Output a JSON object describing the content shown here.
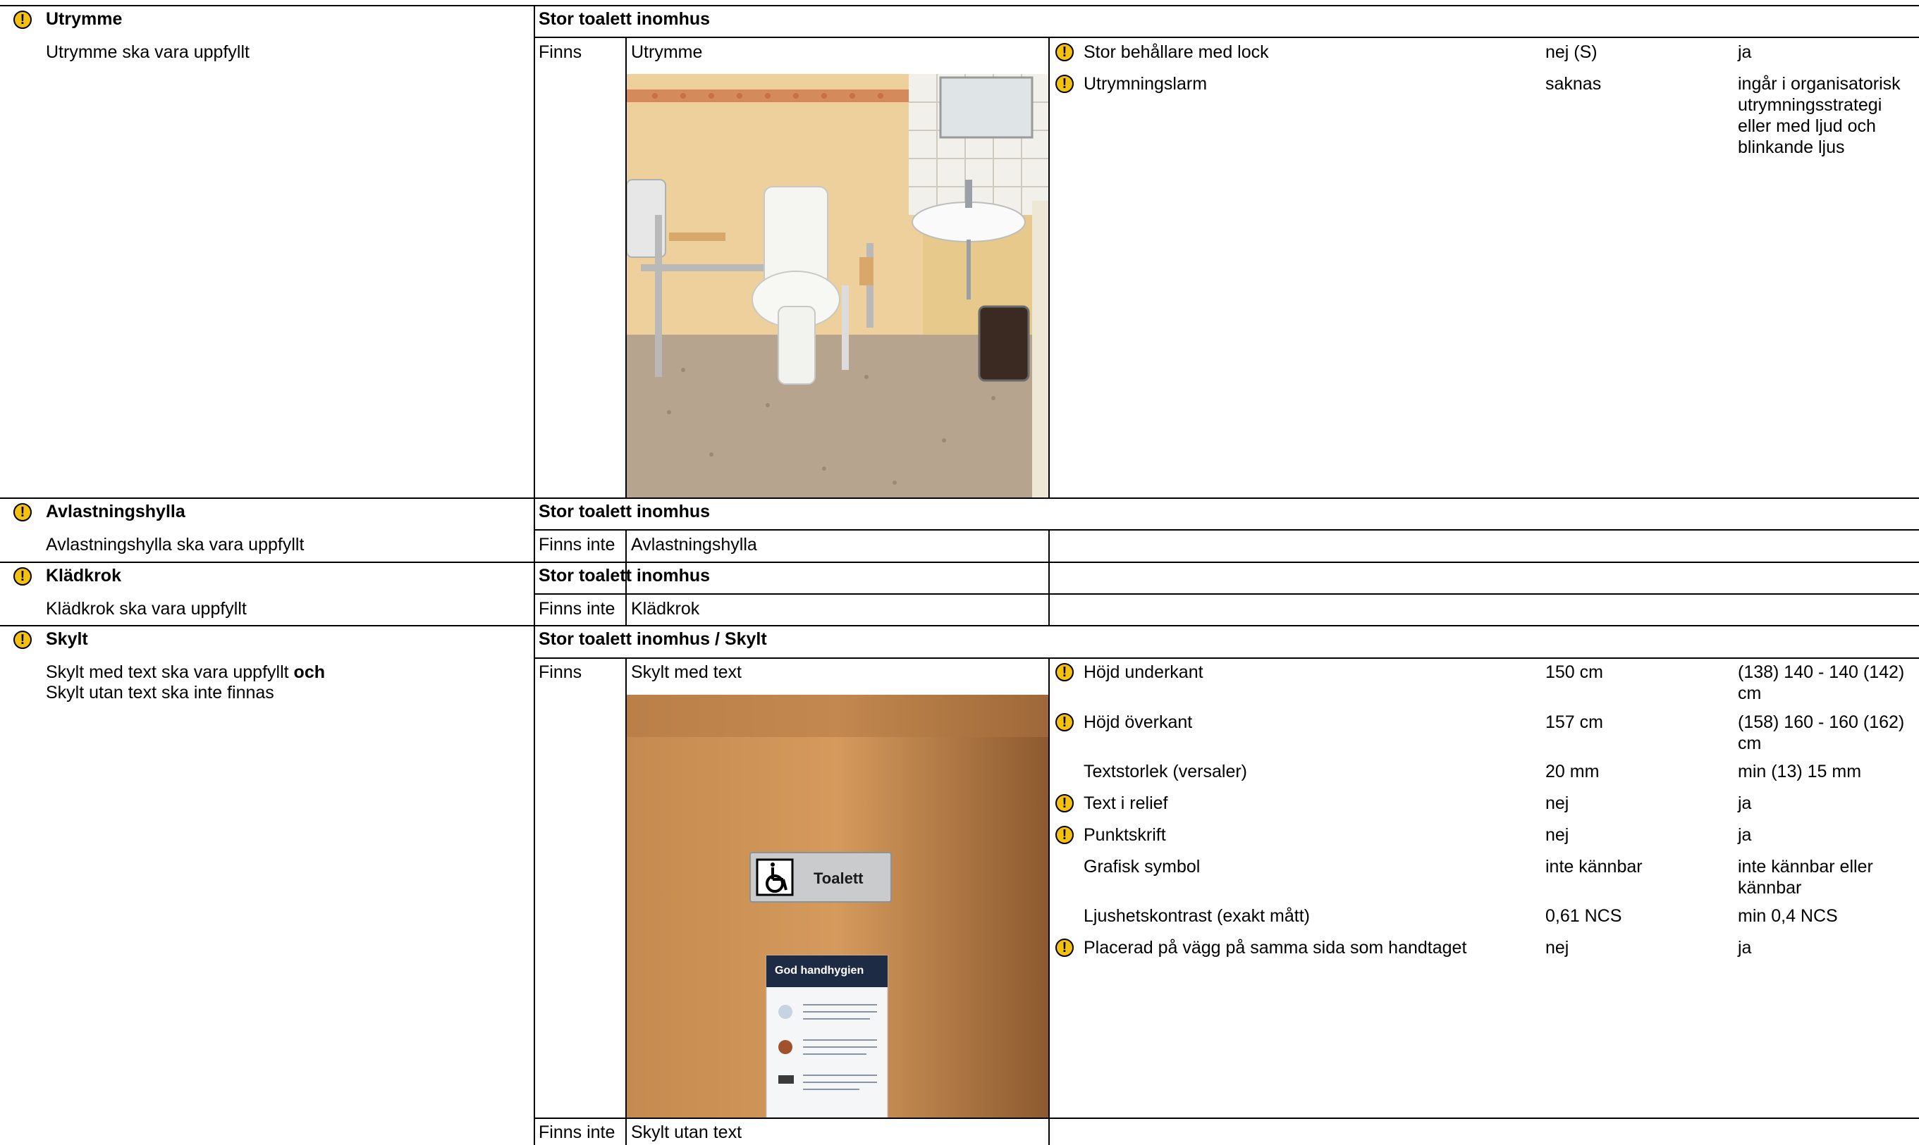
{
  "warning_glyph": "!",
  "colors": {
    "warning": "#f4c20d",
    "border": "#000000"
  },
  "sections": {
    "utrymme": {
      "title": "Utrymme",
      "requirement": "Utrymme ska vara uppfyllt",
      "header": "Stor toalett inomhus",
      "status": "Finns",
      "item": "Utrymme",
      "props": [
        {
          "name": "Stor behållare med lock",
          "value": "nej (S)",
          "req": "ja",
          "warning": true
        },
        {
          "name": "Utrymningslarm",
          "value": "saknas",
          "req": "ingår i organisatorisk utrymningsstrategi eller med ljud och blinkande ljus",
          "warning": true
        }
      ]
    },
    "avlastningshylla": {
      "title": "Avlastningshylla",
      "requirement": "Avlastningshylla ska vara uppfyllt",
      "header": "Stor toalett inomhus",
      "status": "Finns inte",
      "item": "Avlastningshylla"
    },
    "kladkrok": {
      "title": "Klädkrok",
      "requirement": "Klädkrok ska vara uppfyllt",
      "header": "Stor toalett inomhus",
      "status": "Finns inte",
      "item": "Klädkrok"
    },
    "skylt": {
      "title": "Skylt",
      "requirement_1": "Skylt med text ska vara uppfyllt",
      "requirement_1_conj": "och",
      "requirement_2": "Skylt utan text ska inte finnas",
      "header": "Stor toalett inomhus / Skylt",
      "status": "Finns",
      "item": "Skylt med text",
      "sign_text": "Toalett",
      "poster_title": "God handhygien",
      "status_2": "Finns inte",
      "item_2": "Skylt utan text",
      "props": [
        {
          "name": "Höjd underkant",
          "value": "150 cm",
          "req": "(138) 140 - 140 (142) cm",
          "warning": true
        },
        {
          "name": "Höjd överkant",
          "value": "157 cm",
          "req": "(158) 160 - 160 (162) cm",
          "warning": true
        },
        {
          "name": "Textstorlek (versaler)",
          "value": "20 mm",
          "req": "min (13) 15 mm",
          "warning": false
        },
        {
          "name": "Text i relief",
          "value": "nej",
          "req": "ja",
          "warning": true
        },
        {
          "name": "Punktskrift",
          "value": "nej",
          "req": "ja",
          "warning": true
        },
        {
          "name": "Grafisk symbol",
          "value": "inte kännbar",
          "req": "inte kännbar eller kännbar",
          "warning": false
        },
        {
          "name": "Ljushetskontrast (exakt mått)",
          "value": "0,61 NCS",
          "req": "min 0,4 NCS",
          "warning": false
        },
        {
          "name": "Placerad på vägg på samma sida som handtaget",
          "value": "nej",
          "req": "ja",
          "warning": true
        }
      ]
    }
  }
}
